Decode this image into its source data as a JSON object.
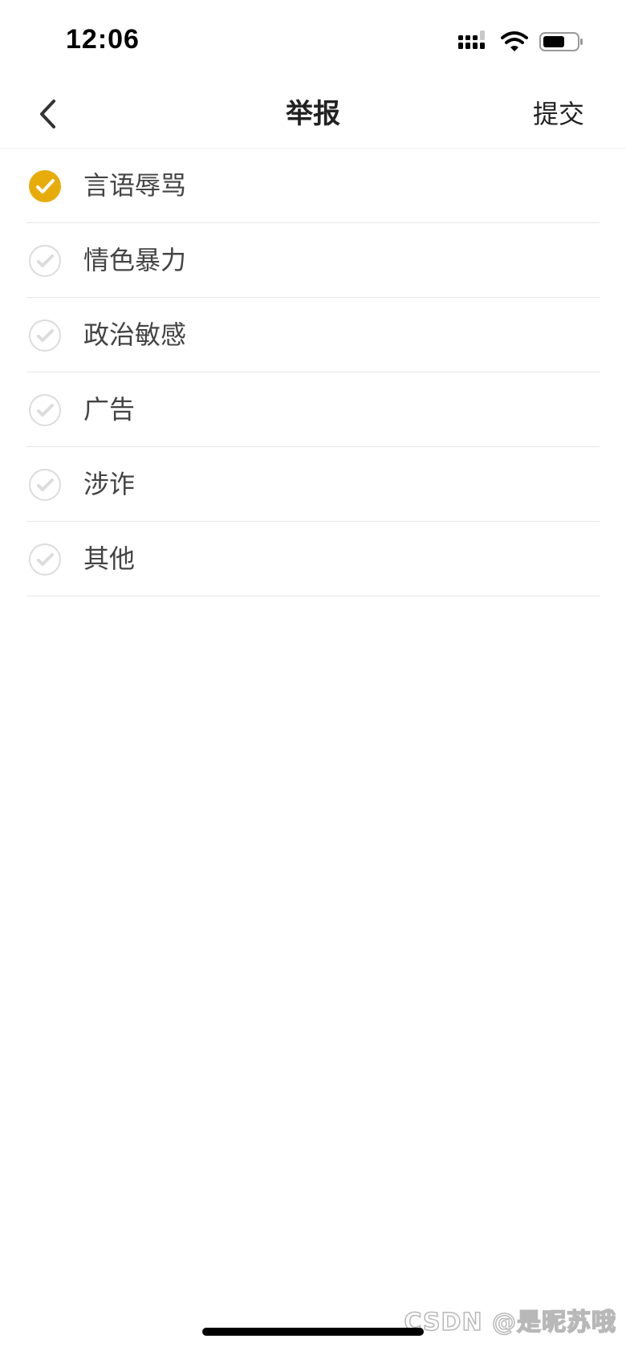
{
  "status_bar": {
    "time": "12:06",
    "icons": [
      "signal-icon",
      "wifi-icon",
      "battery-icon"
    ]
  },
  "nav": {
    "back_icon": "chevron-left-icon",
    "title": "举报",
    "submit_label": "提交"
  },
  "options": [
    {
      "label": "言语辱骂",
      "selected": true
    },
    {
      "label": "情色暴力",
      "selected": false
    },
    {
      "label": "政治敏感",
      "selected": false
    },
    {
      "label": "广告",
      "selected": false
    },
    {
      "label": "涉诈",
      "selected": false
    },
    {
      "label": "其他",
      "selected": false
    }
  ],
  "watermark": "CSDN @是昵苏哦",
  "colors": {
    "accent": "#E8AC0A",
    "unchecked_ring": "#dcdcdc",
    "divider": "#e6e6e6"
  }
}
